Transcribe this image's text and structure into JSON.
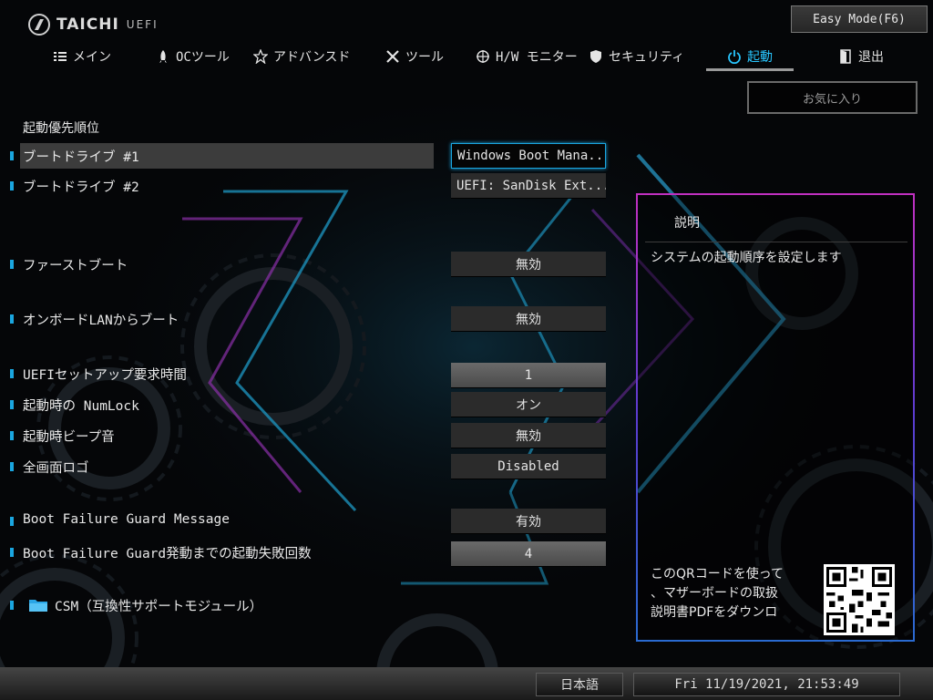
{
  "brand": {
    "name": "TAICHI",
    "sub": "UEFI"
  },
  "easy_mode_label": "Easy Mode(F6)",
  "tabs": [
    {
      "label": "メイン",
      "icon": "list-icon"
    },
    {
      "label": "OCツール",
      "icon": "rocket-icon"
    },
    {
      "label": "アドバンスド",
      "icon": "star-icon"
    },
    {
      "label": "ツール",
      "icon": "tools-icon"
    },
    {
      "label": "H/W モニター",
      "icon": "crosshair-icon"
    },
    {
      "label": "セキュリティ",
      "icon": "shield-icon"
    },
    {
      "label": "起動",
      "icon": "power-icon",
      "active": true
    },
    {
      "label": "退出",
      "icon": "exit-door-icon"
    }
  ],
  "favorites_label": "お気に入り",
  "section_title": "起動優先順位",
  "settings": [
    {
      "label": "ブートドライブ #1",
      "value": "Windows Boot Mana..."
    },
    {
      "label": "ブートドライブ #2",
      "value": "UEFI: SanDisk Ext..."
    },
    {
      "label": "ファーストブート",
      "value": "無効"
    },
    {
      "label": "オンボードLANからブート",
      "value": "無効"
    },
    {
      "label": "UEFIセットアップ要求時間",
      "value": "1"
    },
    {
      "label": "起動時の NumLock",
      "value": "オン"
    },
    {
      "label": "起動時ビープ音",
      "value": "無効"
    },
    {
      "label": "全画面ロゴ",
      "value": "Disabled"
    },
    {
      "label": "Boot Failure Guard Message",
      "value": "有効"
    },
    {
      "label": "Boot Failure Guard発動までの起動失敗回数",
      "value": "4"
    }
  ],
  "csm_label": "CSM（互換性サポートモジュール）",
  "description": {
    "title": "説明",
    "text": "システムの起動順序を設定します",
    "qr_lines": [
      "このQRコードを使って",
      "、マザーボードの取扱",
      "説明書PDFをダウンロ"
    ]
  },
  "footer": {
    "language": "日本語",
    "datetime": "Fri 11/19/2021, 21:53:49"
  },
  "colors": {
    "accent": "#28c6ff",
    "marker": "#1aa6e0",
    "panel_border": "#c030c0"
  }
}
